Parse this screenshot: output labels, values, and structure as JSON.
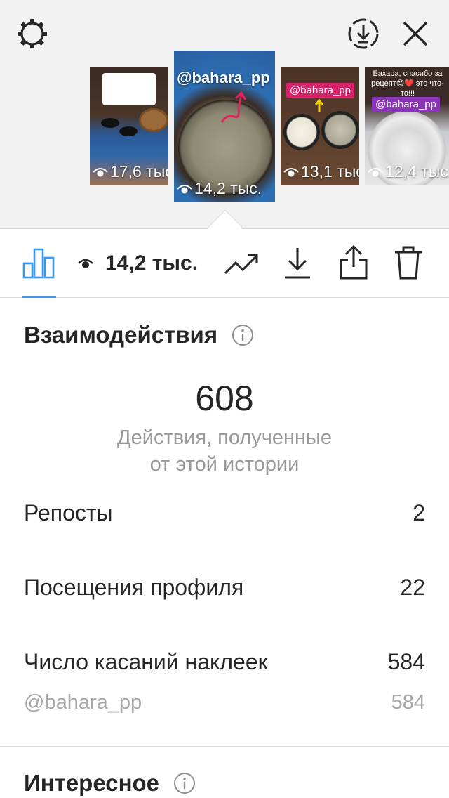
{
  "stories": [
    {
      "views": "17,6 тыс."
    },
    {
      "views": "14,2 тыс.",
      "tag": "@bahara_pp"
    },
    {
      "views": "13,1 тыс.",
      "tag": "@bahara_pp"
    },
    {
      "views": "12,4 тыс.",
      "tag": "@bahara_pp",
      "caption": "Бахара, спасибо за рецепт😍❤️ это что-то!!!"
    }
  ],
  "tabbar": {
    "views_count": "14,2 тыс."
  },
  "interactions": {
    "title": "Взаимодействия",
    "total": "608",
    "subtitle_line1": "Действия, полученные",
    "subtitle_line2": "от этой истории",
    "rows": [
      {
        "label": "Репосты",
        "value": "2"
      },
      {
        "label": "Посещения профиля",
        "value": "22"
      },
      {
        "label": "Число касаний наклеек",
        "value": "584"
      },
      {
        "label": "@bahara_pp",
        "value": "584"
      }
    ]
  },
  "discovery": {
    "title": "Интересное"
  },
  "colors": {
    "accent": "#3897f0",
    "text": "#262626",
    "muted": "#999999"
  }
}
